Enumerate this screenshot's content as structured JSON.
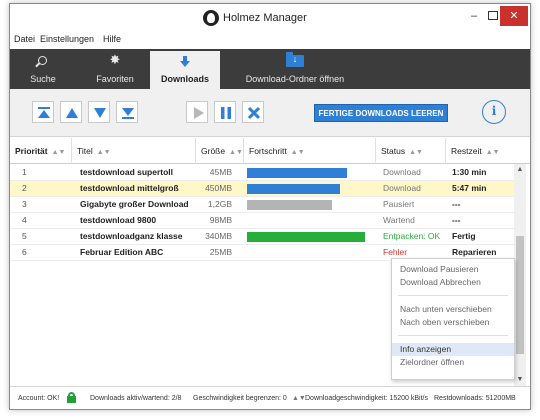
{
  "window": {
    "title": "Holmez Manager",
    "minimize": "–",
    "close": "✕"
  },
  "menu": [
    "Datei",
    "Einstellungen",
    "Hilfe"
  ],
  "nav": {
    "tabs": [
      {
        "label": "Suche",
        "icon": "search-icon"
      },
      {
        "label": "Favoriten",
        "icon": "gear-icon"
      },
      {
        "label": "Downloads",
        "icon": "download-arrow-icon",
        "active": true
      },
      {
        "label": "Download-Ordner öffnen",
        "icon": "folder-download-icon"
      }
    ]
  },
  "toolbar": {
    "clear_label": "FERTIGE DOWNLOADS LEEREN",
    "info_label": "i",
    "accent": "#2f7fd6"
  },
  "table": {
    "headers": [
      "Priorität",
      "Titel",
      "Größe",
      "Fortschritt",
      "Status",
      "Restzeit"
    ],
    "rows": [
      {
        "prio": "1",
        "title": "testdownload supertoll",
        "size": "45MB",
        "progress": 0.85,
        "bar_color": "#2f7fd6",
        "status": "Download",
        "status_color": "#777777",
        "rest": "1:30 min"
      },
      {
        "prio": "2",
        "title": "testdownload mittelgroß",
        "size": "450MB",
        "progress": 0.79,
        "bar_color": "#2f7fd6",
        "status": "Download",
        "status_color": "#777777",
        "rest": "5:47 min",
        "selected": true
      },
      {
        "prio": "3",
        "title": "Gigabyte großer Download",
        "size": "1,2GB",
        "progress": 0.72,
        "bar_color": "#b4b4b4",
        "status": "Pausiert",
        "status_color": "#777777",
        "rest": "---"
      },
      {
        "prio": "4",
        "title": "testdownload 9800",
        "size": "98MB",
        "progress": 0,
        "bar_color": "#b4b4b4",
        "status": "Wartend",
        "status_color": "#777777",
        "rest": "---"
      },
      {
        "prio": "5",
        "title": "testdownloadganz klasse",
        "size": "340MB",
        "progress": 1.0,
        "bar_color": "#27ae3a",
        "status": "Entpacken: OK",
        "status_color": "#27ae3a",
        "rest": "Fertig"
      },
      {
        "prio": "6",
        "title": "Februar Edition ABC",
        "size": "25MB",
        "progress": 0,
        "bar_color": "#b4b4b4",
        "status": "Fehler",
        "status_color": "#d9342b",
        "rest": "Reparieren"
      }
    ]
  },
  "context_menu": {
    "items": [
      {
        "label": "Download Pausieren"
      },
      {
        "label": "Download Abbrechen"
      },
      {
        "separator": true
      },
      {
        "label": "Nach unten verschieben"
      },
      {
        "label": "Nach oben verschieben"
      },
      {
        "separator": true
      },
      {
        "label": "Info anzeigen",
        "highlighted": true
      },
      {
        "label": "Zielordner öffnen"
      }
    ]
  },
  "status": {
    "account": "Account: OK!",
    "downloads": "Downloads aktiv/wartend: 2/8",
    "speed_limit": "Geschwindigkeit begrenzen: 0",
    "speed_limit_stepper": "▲▼",
    "speed": "Downloadgeschwindigkeit: 15200 kBit/s",
    "rest": "Restdownloads: 51200MB"
  }
}
